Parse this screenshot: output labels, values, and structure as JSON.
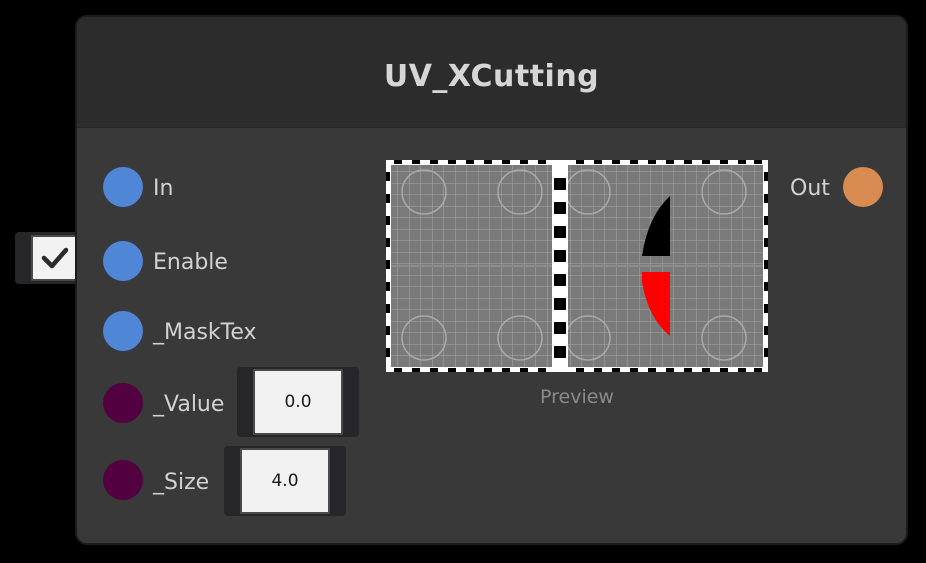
{
  "node": {
    "title": "UV_XCutting",
    "inputs": [
      {
        "label": "In",
        "port_color": "#4f86d6"
      },
      {
        "label": "Enable",
        "port_color": "#4f86d6"
      },
      {
        "label": "_MaskTex",
        "port_color": "#4f86d6"
      },
      {
        "label": "_Value",
        "port_color": "#530040"
      },
      {
        "label": "_Size",
        "port_color": "#530040"
      }
    ],
    "output": {
      "label": "Out",
      "port_color": "#d88b50"
    },
    "enable_checked": true,
    "value_field": "0.0",
    "size_field": "4.0",
    "preview_label": "Preview"
  },
  "icons": {
    "checkbox": "checkmark-icon",
    "preview": "uv-preview-image"
  },
  "colors": {
    "background": "#000000",
    "node_body": "#393939",
    "node_header": "#2c2c2c",
    "port_blue": "#4f86d6",
    "port_purple": "#530040",
    "port_orange": "#d88b50",
    "preview_shape_dark": "#000000",
    "preview_shape_red": "#ff0000"
  }
}
